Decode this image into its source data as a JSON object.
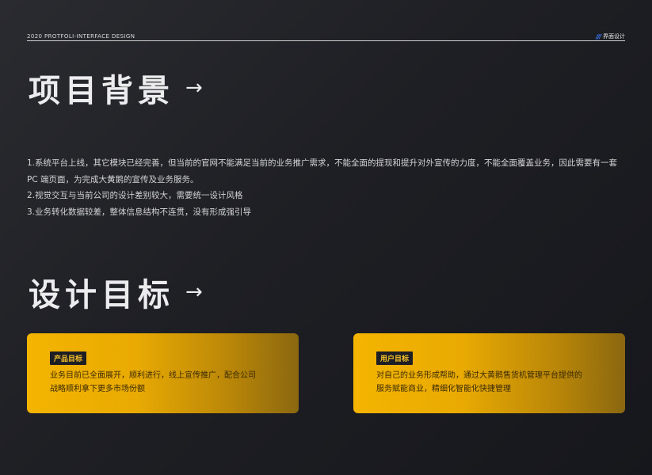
{
  "header": {
    "left_label": "2020 PROTFOLI-INTERFACE DESIGN",
    "right_slashes": "///",
    "right_label": "界面设计"
  },
  "background_section": {
    "title": "项目背景",
    "arrow": "→",
    "lines": [
      "1.系统平台上线，其它模块已经完善，但当前的官网不能满足当前的业务推广需求，不能全面的提现和提升对外宣传的力度，不能全面覆盖业务，因此需要有一套 PC 端页面，为完成大黄鹅的宣传及业务服务。",
      "2.视觉交互与当前公司的设计差别较大，需要统一设计风格",
      "3.业务转化数据较差，整体信息结构不连贯，没有形成强引导"
    ]
  },
  "goals_section": {
    "title": "设计目标",
    "arrow": "→",
    "cards": [
      {
        "tag": "产品目标",
        "body": "业务目前已全面展开，顺利进行，线上宣传推广，配合公司战略顺利拿下更多市场份额"
      },
      {
        "tag": "用户目标",
        "body": "对自己的业务形成帮助，通过大黄鹅售货机管理平台提供的服务赋能商业，精细化智能化快捷管理"
      }
    ]
  },
  "colors": {
    "accent": "#f4b400",
    "background": "#1e1f24",
    "slash": "#3a7bff"
  }
}
